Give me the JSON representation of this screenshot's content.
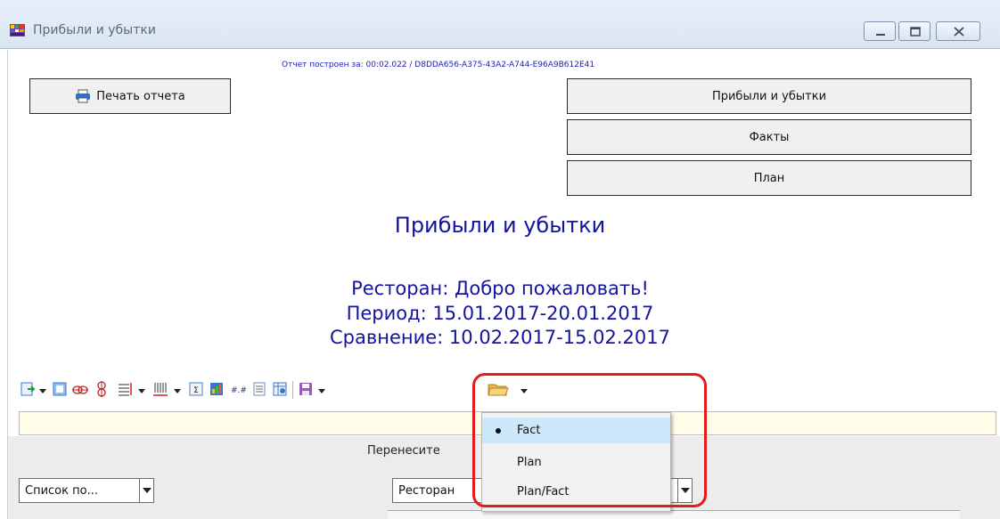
{
  "window": {
    "title": "Прибыли и убытки"
  },
  "report": {
    "built_info": "Отчет построен за: 00:02.022 / D8DDA656-A375-43A2-A744-E96A9B612E41",
    "print_button": "Печать отчета",
    "nav_buttons": [
      "Прибыли и убытки",
      "Факты",
      "План"
    ],
    "title": "Прибыли и убытки",
    "restaurant_line": "Ресторан: Добро пожаловать!",
    "period_line": "Период: 15.01.2017-20.01.2017",
    "comparison_line": "Сравнение: 10.02.2017-15.02.2017"
  },
  "pivot": {
    "drop_hint": "Перенесите",
    "left_combo": "Список по...",
    "right_combo": "Ресторан"
  },
  "dropdown_menu": {
    "items": [
      "Fact",
      "Plan",
      "Plan/Fact"
    ],
    "selected": "Fact"
  },
  "colors": {
    "heading_blue": "#14149c",
    "highlight_red": "#e21b1b",
    "menu_selected": "#cde8fb"
  },
  "icons": [
    "print-icon",
    "export-icon",
    "grid-icon",
    "link-icon",
    "bookmark-icon",
    "lines-icon",
    "columns-icon",
    "sum-icon",
    "chart-icon",
    "format-icon",
    "text-icon",
    "table-icon",
    "save-icon",
    "open-folder-icon"
  ]
}
